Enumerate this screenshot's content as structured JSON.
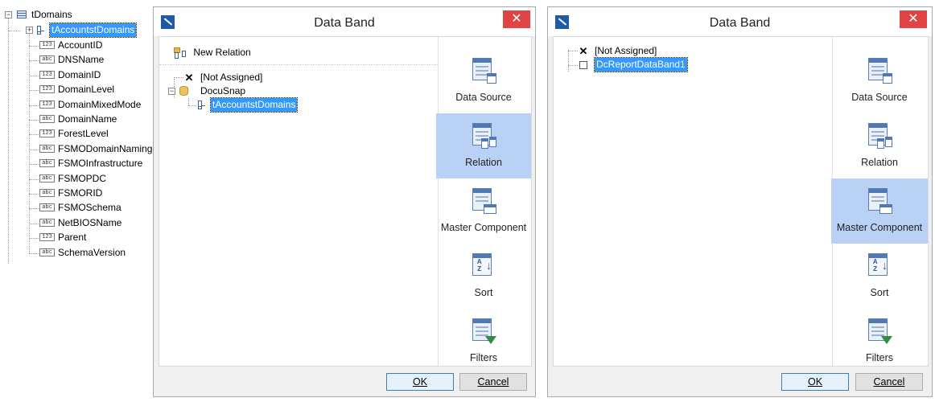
{
  "schema_tree": {
    "root": {
      "label": "tDomains"
    },
    "selected": {
      "label": "tAccountstDomains"
    },
    "fields": [
      {
        "type": "123",
        "name": "AccountID"
      },
      {
        "type": "abc",
        "name": "DNSName"
      },
      {
        "type": "123",
        "name": "DomainID"
      },
      {
        "type": "123",
        "name": "DomainLevel"
      },
      {
        "type": "123",
        "name": "DomainMixedMode"
      },
      {
        "type": "abc",
        "name": "DomainName"
      },
      {
        "type": "123",
        "name": "ForestLevel"
      },
      {
        "type": "abc",
        "name": "FSMODomainNaming"
      },
      {
        "type": "abc",
        "name": "FSMOInfrastructure"
      },
      {
        "type": "abc",
        "name": "FSMOPDC"
      },
      {
        "type": "abc",
        "name": "FSMORID"
      },
      {
        "type": "abc",
        "name": "FSMOSchema"
      },
      {
        "type": "abc",
        "name": "NetBIOSName"
      },
      {
        "type": "123",
        "name": "Parent"
      },
      {
        "type": "abc",
        "name": "SchemaVersion"
      }
    ]
  },
  "dialog1": {
    "title": "Data Band",
    "close": "✕",
    "new_relation": "New Relation",
    "tree": {
      "not_assigned": "[Not Assigned]",
      "source": "DocuSnap",
      "relation": "tAccountstDomains"
    },
    "side": [
      {
        "label": "Data Source"
      },
      {
        "label": "Relation"
      },
      {
        "label": "Master Component"
      },
      {
        "label": "Sort"
      },
      {
        "label": "Filters"
      }
    ],
    "ok": "OK",
    "cancel": "Cancel"
  },
  "dialog2": {
    "title": "Data Band",
    "close": "✕",
    "tree": {
      "not_assigned": "[Not Assigned]",
      "band": "DcReportDataBand1"
    },
    "side": [
      {
        "label": "Data Source"
      },
      {
        "label": "Relation"
      },
      {
        "label": "Master Component"
      },
      {
        "label": "Sort"
      },
      {
        "label": "Filters"
      }
    ],
    "ok": "OK",
    "cancel": "Cancel"
  },
  "colors": {
    "selection": "#3399ff",
    "active_side": "#b9d1f5",
    "close": "#e04343"
  }
}
